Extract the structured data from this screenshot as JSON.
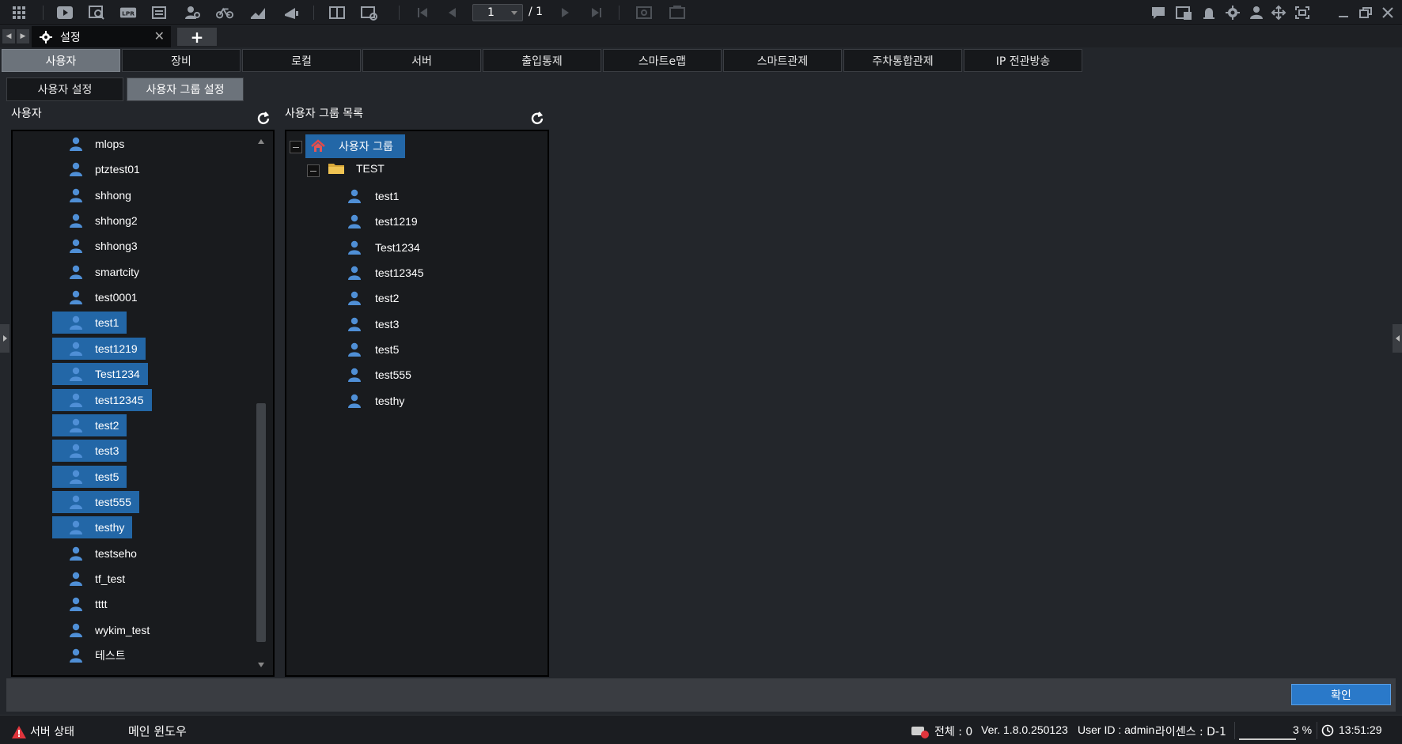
{
  "toolbar": {
    "page_current": "1",
    "page_total": "/ 1"
  },
  "doc_tab": {
    "title": "설정"
  },
  "main_tabs": [
    {
      "label": "사용자",
      "active": true
    },
    {
      "label": "장비"
    },
    {
      "label": "로컬"
    },
    {
      "label": "서버"
    },
    {
      "label": "출입통제"
    },
    {
      "label": "스마트e맵"
    },
    {
      "label": "스마트관제"
    },
    {
      "label": "주차통합관제"
    },
    {
      "label": "IP 전관방송"
    }
  ],
  "sub_tabs": [
    {
      "label": "사용자 설정"
    },
    {
      "label": "사용자 그룹 설정",
      "active": true
    }
  ],
  "user_panel": {
    "title": "사용자",
    "users": [
      {
        "name": "mlops",
        "selected": false
      },
      {
        "name": "ptztest01",
        "selected": false
      },
      {
        "name": "shhong",
        "selected": false
      },
      {
        "name": "shhong2",
        "selected": false
      },
      {
        "name": "shhong3",
        "selected": false
      },
      {
        "name": "smartcity",
        "selected": false
      },
      {
        "name": "test0001",
        "selected": false
      },
      {
        "name": "test1",
        "selected": true
      },
      {
        "name": "test1219",
        "selected": true
      },
      {
        "name": "Test1234",
        "selected": true
      },
      {
        "name": "test12345",
        "selected": true
      },
      {
        "name": "test2",
        "selected": true
      },
      {
        "name": "test3",
        "selected": true
      },
      {
        "name": "test5",
        "selected": true
      },
      {
        "name": "test555",
        "selected": true
      },
      {
        "name": "testhy",
        "selected": true
      },
      {
        "name": "testseho",
        "selected": false
      },
      {
        "name": "tf_test",
        "selected": false
      },
      {
        "name": "tttt",
        "selected": false
      },
      {
        "name": "wykim_test",
        "selected": false
      },
      {
        "name": "테스트",
        "selected": false
      }
    ]
  },
  "group_panel": {
    "title": "사용자 그룹 목록",
    "root_label": "사용자 그룹",
    "folder_label": "TEST",
    "members": [
      "test1",
      "test1219",
      "Test1234",
      "test12345",
      "test2",
      "test3",
      "test5",
      "test555",
      "testhy"
    ]
  },
  "footer": {
    "confirm_label": "확인"
  },
  "status": {
    "server_status": "서버 상태",
    "main_window": "메인 윈도우",
    "total": "전체 : 0",
    "version": "Ver. 1.8.0.250123",
    "user_id": "User ID : admin",
    "license": "라이센스 : D-1",
    "cpu": "3 %",
    "time": "13:51:29"
  },
  "colors": {
    "selection": "#2367a7",
    "active_tab": "#6c737b",
    "confirm_button": "#2a79c9"
  }
}
